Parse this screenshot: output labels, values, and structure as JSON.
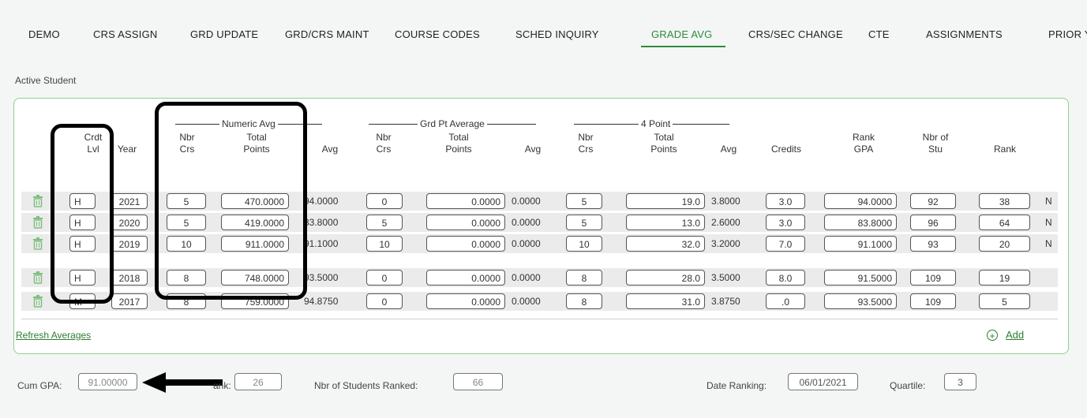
{
  "tabs": [
    {
      "label": "DEMO",
      "active": false
    },
    {
      "label": "CRS ASSIGN",
      "active": false
    },
    {
      "label": "GRD UPDATE",
      "active": false
    },
    {
      "label": "GRD/CRS MAINT",
      "active": false
    },
    {
      "label": "COURSE CODES",
      "active": false
    },
    {
      "label": "SCHED INQUIRY",
      "active": false
    },
    {
      "label": "GRADE AVG",
      "active": true
    },
    {
      "label": "CRS/SEC CHANGE",
      "active": false
    },
    {
      "label": "CTE",
      "active": false
    },
    {
      "label": "ASSIGNMENTS",
      "active": false
    },
    {
      "label": "PRIOR Y",
      "active": false
    }
  ],
  "section_label": "Active Student",
  "groups": {
    "numeric": "Numeric Avg",
    "grdpt": "Grd Pt Average",
    "four": "4 Point"
  },
  "headers": {
    "crdt": [
      "Crdt",
      "Lvl"
    ],
    "year": "Year",
    "nbr1": [
      "Nbr",
      "Crs"
    ],
    "tp1": [
      "Total",
      "Points"
    ],
    "avg1": "Avg",
    "nbr2": [
      "Nbr",
      "Crs"
    ],
    "tp2": [
      "Total",
      "Points"
    ],
    "avg2": "Avg",
    "nbr3": [
      "Nbr",
      "Crs"
    ],
    "tp3": [
      "Total",
      "Points"
    ],
    "avg3": "Avg",
    "credits": "Credits",
    "rankgpa": [
      "Rank",
      "GPA"
    ],
    "nbrstu": [
      "Nbr of",
      "Stu"
    ],
    "rank": "Rank"
  },
  "rows": [
    {
      "lvl": "H",
      "year": "2021",
      "nbr1": "5",
      "tp1": "470.0000",
      "avg1": "94.0000",
      "nbr2": "0",
      "tp2": "0.0000",
      "avg2": "0.0000",
      "nbr3": "5",
      "tp3": "19.0",
      "avg3": "3.8000",
      "credits": "3.0",
      "rankgpa": "94.0000",
      "nbrstu": "92",
      "rank": "38",
      "flag": "N"
    },
    {
      "lvl": "H",
      "year": "2020",
      "nbr1": "5",
      "tp1": "419.0000",
      "avg1": "83.8000",
      "nbr2": "5",
      "tp2": "0.0000",
      "avg2": "0.0000",
      "nbr3": "5",
      "tp3": "13.0",
      "avg3": "2.6000",
      "credits": "3.0",
      "rankgpa": "83.8000",
      "nbrstu": "96",
      "rank": "64",
      "flag": "N"
    },
    {
      "lvl": "H",
      "year": "2019",
      "nbr1": "10",
      "tp1": "911.0000",
      "avg1": "91.1000",
      "nbr2": "10",
      "tp2": "0.0000",
      "avg2": "0.0000",
      "nbr3": "10",
      "tp3": "32.0",
      "avg3": "3.2000",
      "credits": "7.0",
      "rankgpa": "91.1000",
      "nbrstu": "93",
      "rank": "20",
      "flag": "N"
    },
    {
      "lvl": "H",
      "year": "2018",
      "nbr1": "8",
      "tp1": "748.0000",
      "avg1": "93.5000",
      "nbr2": "0",
      "tp2": "0.0000",
      "avg2": "0.0000",
      "nbr3": "8",
      "tp3": "28.0",
      "avg3": "3.5000",
      "credits": "8.0",
      "rankgpa": "91.5000",
      "nbrstu": "109",
      "rank": "19",
      "flag": ""
    },
    {
      "lvl": "M",
      "year": "2017",
      "nbr1": "8",
      "tp1": "759.0000",
      "avg1": "94.8750",
      "nbr2": "0",
      "tp2": "0.0000",
      "avg2": "0.0000",
      "nbr3": "8",
      "tp3": "31.0",
      "avg3": "3.8750",
      "credits": ".0",
      "rankgpa": "93.5000",
      "nbrstu": "109",
      "rank": "5",
      "flag": ""
    }
  ],
  "refresh_label": "Refresh Averages",
  "add_label": "Add",
  "footer": {
    "cum_gpa_label": "Cum GPA:",
    "cum_gpa_value": "91.00000",
    "rank_label": "ank:",
    "rank_value": "26",
    "nbr_ranked_label": "Nbr of Students Ranked:",
    "nbr_ranked_value": "66",
    "date_ranking_label": "Date Ranking:",
    "date_ranking_value": "06/01/2021",
    "quartile_label": "Quartile:",
    "quartile_value": "3"
  },
  "colors": {
    "accent": "#2e8b3d",
    "panel_border": "#8fd18a"
  },
  "icons": {
    "delete": "trash-icon",
    "add": "plus-circle-icon",
    "callout": "arrow-left-icon"
  }
}
